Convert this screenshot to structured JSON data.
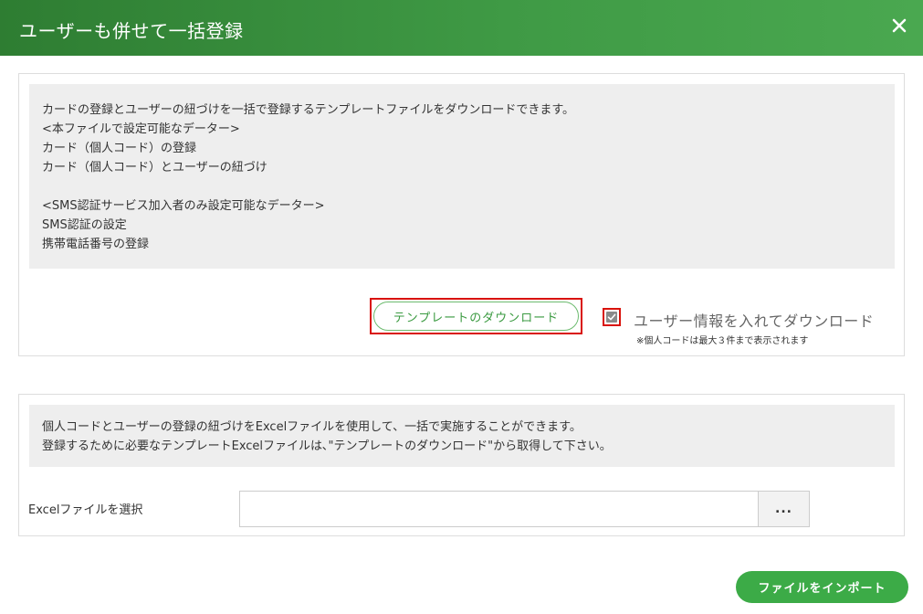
{
  "dialog": {
    "title": "ユーザーも併せて一括登録",
    "close_icon": "close-icon"
  },
  "download_section": {
    "info_lines": [
      "カードの登録とユーザーの紐づけを一括で登録するテンプレートファイルをダウンロードできます。",
      "<本ファイルで設定可能なデーター>",
      "カード（個人コード）の登録",
      "カード（個人コード）とユーザーの紐づけ",
      "",
      "<SMS認証サービス加入者のみ設定可能なデーター>",
      "SMS認証の設定",
      "携帯電話番号の登録"
    ],
    "download_button_label": "テンプレートのダウンロード",
    "checkbox": {
      "label": "ユーザー情報を入れてダウンロード",
      "checked": true,
      "note": "※個人コードは最大３件まで表示されます"
    }
  },
  "import_section": {
    "info_lines": [
      "個人コードとユーザーの登録の紐づけをExcelファイルを使用して、一括で実施することができます。",
      "登録するために必要なテンプレートExcelファイルは､\"テンプレートのダウンロード\"から取得して下さい。"
    ],
    "file_label": "Excelファイルを選択",
    "file_value": "",
    "browse_label": "..."
  },
  "footer": {
    "import_button_label": "ファイルをインポート"
  },
  "colors": {
    "header_start": "#2e7d32",
    "header_end": "#4aa850",
    "accent_green": "#3cab47",
    "highlight_red": "#d9120b"
  }
}
